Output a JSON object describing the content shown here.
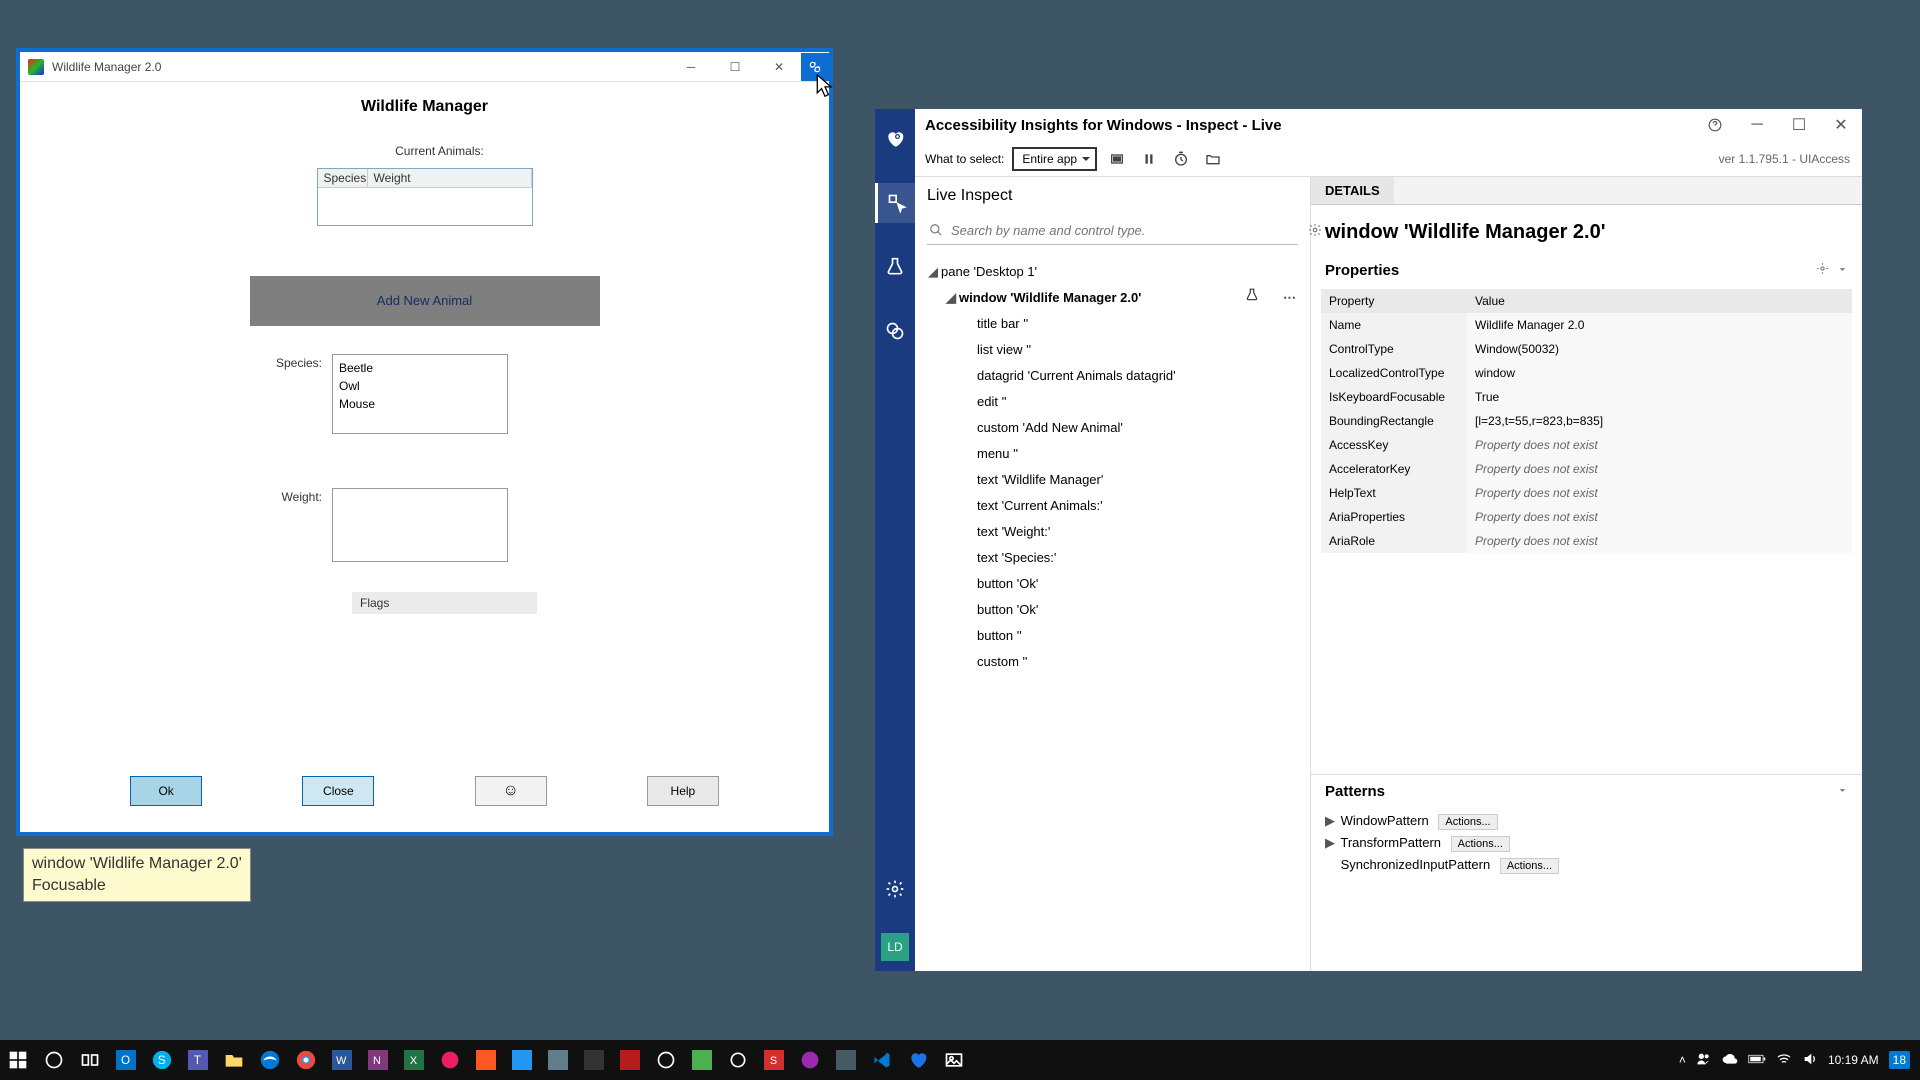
{
  "wildlife": {
    "window_title": "Wildlife Manager 2.0",
    "heading": "Wildlife Manager",
    "current_animals_label": "Current Animals:",
    "grid_headers": {
      "species": "Species",
      "weight": "Weight"
    },
    "add_button": "Add New Animal",
    "species_label": "Species:",
    "species_options": [
      "Beetle",
      "Owl",
      "Mouse"
    ],
    "weight_label": "Weight:",
    "flags_label": "Flags",
    "buttons": {
      "ok": "Ok",
      "close": "Close",
      "emoji": "☺",
      "help": "Help"
    }
  },
  "tooltip": {
    "line1": "window 'Wildlife Manager 2.0'",
    "line2": "Focusable"
  },
  "insights": {
    "title": "Accessibility Insights for Windows - Inspect - Live",
    "what_to_select_label": "What to select:",
    "what_to_select_value": "Entire app",
    "version": "ver 1.1.795.1 - UIAccess",
    "live_inspect": "Live Inspect",
    "search_placeholder": "Search by name and control type.",
    "tree": [
      {
        "indent": 0,
        "twisty": "◢",
        "label": "pane 'Desktop 1'"
      },
      {
        "indent": 1,
        "twisty": "◢",
        "label": "window 'Wildlife Manager 2.0'",
        "selected": true,
        "beaker": true,
        "dots": true
      },
      {
        "indent": 2,
        "twisty": "",
        "label": "title bar ''"
      },
      {
        "indent": 2,
        "twisty": "",
        "label": "list view ''"
      },
      {
        "indent": 2,
        "twisty": "",
        "label": "datagrid 'Current Animals datagrid'"
      },
      {
        "indent": 2,
        "twisty": "",
        "label": "edit ''"
      },
      {
        "indent": 2,
        "twisty": "",
        "label": "custom 'Add New Animal'"
      },
      {
        "indent": 2,
        "twisty": "",
        "label": "menu ''"
      },
      {
        "indent": 2,
        "twisty": "",
        "label": "text 'Wildlife Manager'"
      },
      {
        "indent": 2,
        "twisty": "",
        "label": "text 'Current Animals:'"
      },
      {
        "indent": 2,
        "twisty": "",
        "label": "text 'Weight:'"
      },
      {
        "indent": 2,
        "twisty": "",
        "label": "text 'Species:'"
      },
      {
        "indent": 2,
        "twisty": "",
        "label": "button 'Ok'"
      },
      {
        "indent": 2,
        "twisty": "",
        "label": "button 'Ok'"
      },
      {
        "indent": 2,
        "twisty": "",
        "label": "button ''"
      },
      {
        "indent": 2,
        "twisty": "",
        "label": "custom ''"
      }
    ],
    "details_tab": "DETAILS",
    "element_title": "window 'Wildlife Manager 2.0'",
    "properties_heading": "Properties",
    "prop_header": {
      "property": "Property",
      "value": "Value"
    },
    "properties": [
      {
        "k": "Name",
        "v": "Wildlife Manager 2.0"
      },
      {
        "k": "ControlType",
        "v": "Window(50032)"
      },
      {
        "k": "LocalizedControlType",
        "v": "window"
      },
      {
        "k": "IsKeyboardFocusable",
        "v": "True"
      },
      {
        "k": "BoundingRectangle",
        "v": "[l=23,t=55,r=823,b=835]"
      },
      {
        "k": "AccessKey",
        "v": "Property does not exist",
        "ne": true
      },
      {
        "k": "AcceleratorKey",
        "v": "Property does not exist",
        "ne": true
      },
      {
        "k": "HelpText",
        "v": "Property does not exist",
        "ne": true
      },
      {
        "k": "AriaProperties",
        "v": "Property does not exist",
        "ne": true
      },
      {
        "k": "AriaRole",
        "v": "Property does not exist",
        "ne": true
      }
    ],
    "patterns_heading": "Patterns",
    "patterns": [
      {
        "twisty": "▶",
        "name": "WindowPattern",
        "actions": "Actions..."
      },
      {
        "twisty": "▶",
        "name": "TransformPattern",
        "actions": "Actions..."
      },
      {
        "twisty": "",
        "name": "SynchronizedInputPattern",
        "actions": "Actions..."
      }
    ],
    "sidebar_ld": "LD"
  },
  "taskbar": {
    "time": "10:19 AM",
    "date": "",
    "notif_badge": "18"
  }
}
